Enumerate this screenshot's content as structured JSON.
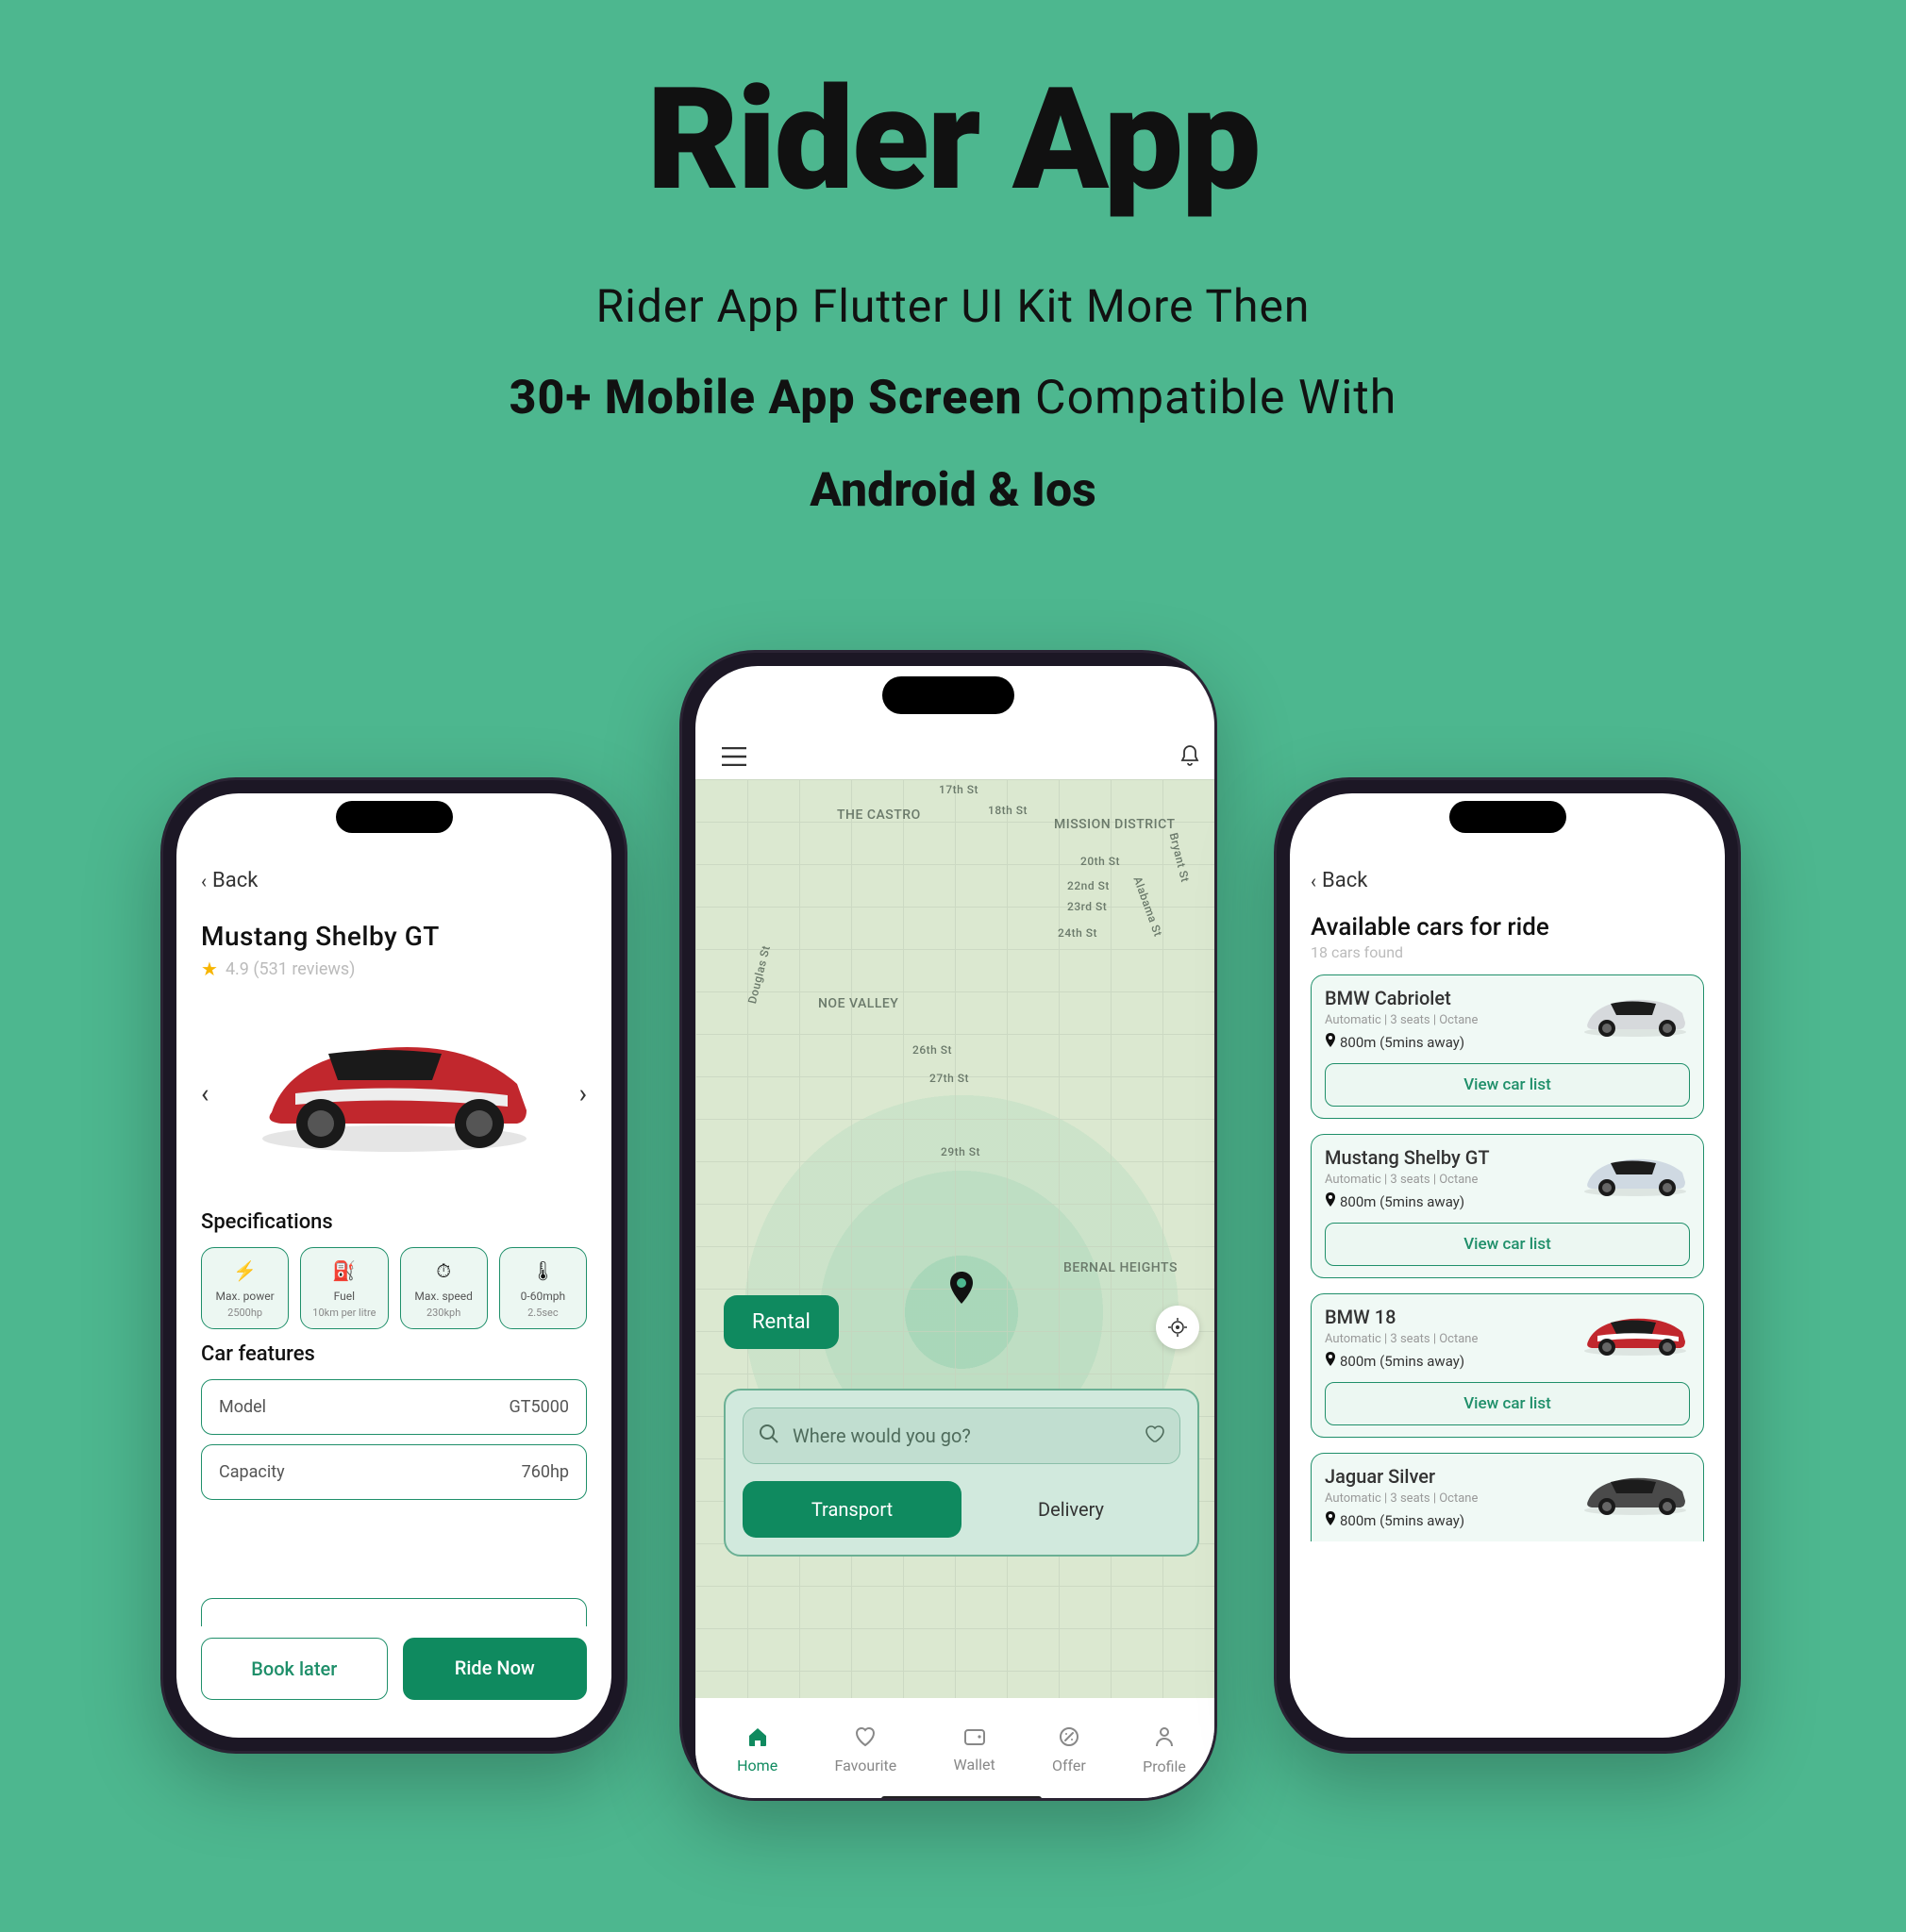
{
  "hero": {
    "title": "Rider App",
    "line1": "Rider App Flutter UI Kit More Then",
    "line2_bold": "30+ Mobile App Screen",
    "line2_rest": " Compatible With",
    "line3": "Android & Ios"
  },
  "left": {
    "back": "Back",
    "car_title": "Mustang Shelby GT",
    "rating": "4.9 (531 reviews)",
    "spec_header": "Specifications",
    "specs": [
      {
        "icon": "⚡",
        "label": "Max. power",
        "value": "2500hp"
      },
      {
        "icon": "⛽",
        "label": "Fuel",
        "value": "10km per litre"
      },
      {
        "icon": "⏱",
        "label": "Max. speed",
        "value": "230kph"
      },
      {
        "icon": "🌡",
        "label": "0-60mph",
        "value": "2.5sec"
      }
    ],
    "feat_header": "Car features",
    "features": [
      {
        "name": "Model",
        "value": "GT5000"
      },
      {
        "name": "Capacity",
        "value": "760hp"
      }
    ],
    "btn_later": "Book later",
    "btn_ride": "Ride Now"
  },
  "center": {
    "map_labels": {
      "castro": "THE CASTRO",
      "mission": "MISSION DISTRICT",
      "noe": "NOE VALLEY",
      "bernal": "BERNAL HEIGHTS",
      "s17": "17th St",
      "s18": "18th St",
      "s20": "20th St",
      "s22": "22nd St",
      "s23": "23rd St",
      "s24": "24th St",
      "s26": "26th St",
      "s27": "27th St",
      "s29": "29th St",
      "bryant": "Bryant St",
      "alabama": "Alabama St",
      "douglas": "Douglas St"
    },
    "rental": "Rental",
    "search_placeholder": "Where would you go?",
    "toggle": {
      "transport": "Transport",
      "delivery": "Delivery"
    },
    "nav": [
      "Home",
      "Favourite",
      "Wallet",
      "Offer",
      "Profile"
    ]
  },
  "right": {
    "back": "Back",
    "title": "Available cars for ride",
    "sub": "18 cars found",
    "meta": "Automatic   |   3 seats   |   Octane",
    "distance": "800m (5mins away)",
    "view": "View car list",
    "cars": [
      {
        "name": "BMW Cabriolet",
        "color": "#d6d9dc"
      },
      {
        "name": "Mustang Shelby GT",
        "color": "#cfd9e2"
      },
      {
        "name": "BMW 18",
        "color": "#c1272d"
      },
      {
        "name": "Jaguar Silver",
        "color": "#4a4a4a"
      }
    ]
  }
}
